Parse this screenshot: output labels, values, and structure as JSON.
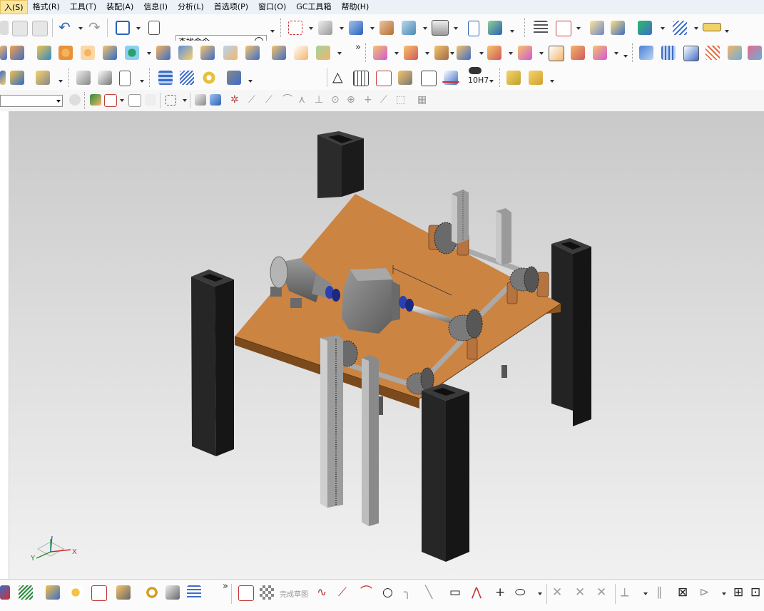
{
  "menu": {
    "items": [
      "入(S)",
      "格式(R)",
      "工具(T)",
      "装配(A)",
      "信息(I)",
      "分析(L)",
      "首选项(P)",
      "窗口(O)",
      "GC工具箱",
      "帮助(H)"
    ]
  },
  "toolbar": {
    "search_value": "查找命令",
    "tolerance_label": "10H7",
    "overflow_glyph": "»"
  },
  "bottom_toolbar": {
    "finish_sketch_label": "完成草图"
  },
  "viewport": {
    "triad": {
      "x_label": "X",
      "y_label": "Y"
    }
  },
  "colors": {
    "plate": "#cc8442",
    "post": "#262626",
    "housing": "#7f7f7f",
    "coupling": "#2a3fb0"
  }
}
